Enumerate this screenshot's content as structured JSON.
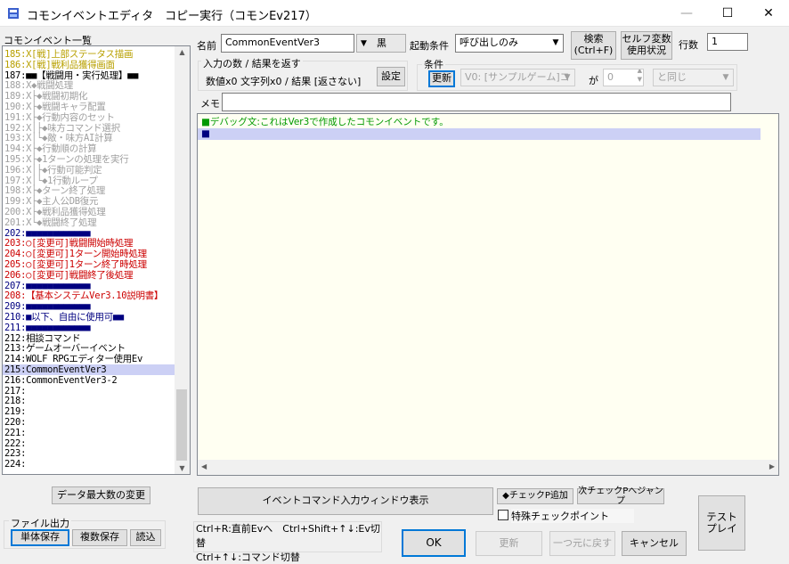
{
  "window": {
    "title": "コモンイベントエディタ　コピー実行（コモンEv217）",
    "minimize": "—",
    "maximize": "☐",
    "close": "✕"
  },
  "list": {
    "header": "コモンイベント一覧",
    "items": [
      {
        "text": "185:X[戦]上部ステータス描画",
        "color": "#b8a000"
      },
      {
        "text": "186:X[戦]戦利品獲得画面",
        "color": "#b8a000"
      },
      {
        "text": "187:■■【戦闘用・実行処理】■■",
        "color": "#000000"
      },
      {
        "text": "188:X◆戦闘処理",
        "color": "#a0a0a0"
      },
      {
        "text": "189:X├◆戦闘初期化",
        "color": "#a0a0a0"
      },
      {
        "text": "190:X├◆戦闘キャラ配置",
        "color": "#a0a0a0"
      },
      {
        "text": "191:X├◆行動内容のセット",
        "color": "#a0a0a0"
      },
      {
        "text": "192:X│├◆味方コマンド選択",
        "color": "#a0a0a0"
      },
      {
        "text": "193:X│└◆敵・味方AI計算",
        "color": "#a0a0a0"
      },
      {
        "text": "194:X├◆行動順の計算",
        "color": "#a0a0a0"
      },
      {
        "text": "195:X├◆1ターンの処理を実行",
        "color": "#a0a0a0"
      },
      {
        "text": "196:X│├◆行動可能判定",
        "color": "#a0a0a0"
      },
      {
        "text": "197:X│└◆1行動ループ",
        "color": "#a0a0a0"
      },
      {
        "text": "198:X├◆ターン終了処理",
        "color": "#a0a0a0"
      },
      {
        "text": "199:X├◆主人公DB復元",
        "color": "#a0a0a0"
      },
      {
        "text": "200:X├◆戦利品獲得処理",
        "color": "#a0a0a0"
      },
      {
        "text": "201:X└◆戦闘終了処理",
        "color": "#a0a0a0"
      },
      {
        "text": "202:■■■■■■■■■■■■",
        "color": "#000080"
      },
      {
        "text": "203:○[変更可]戦闘開始時処理",
        "color": "#cc0000"
      },
      {
        "text": "204:○[変更可]1ターン開始時処理",
        "color": "#cc0000"
      },
      {
        "text": "205:○[変更可]1ターン終了時処理",
        "color": "#cc0000"
      },
      {
        "text": "206:○[変更可]戦闘終了後処理",
        "color": "#cc0000"
      },
      {
        "text": "207:■■■■■■■■■■■■",
        "color": "#000080"
      },
      {
        "text": "208:【基本システムVer3.10説明書】",
        "color": "#cc0000"
      },
      {
        "text": "209:■■■■■■■■■■■■",
        "color": "#000080"
      },
      {
        "text": "210:■以下、自由に使用可■■",
        "color": "#000080"
      },
      {
        "text": "211:■■■■■■■■■■■■",
        "color": "#000080"
      },
      {
        "text": "212:相談コマンド",
        "color": "#000000"
      },
      {
        "text": "213:ゲームオーバーイベント",
        "color": "#000000"
      },
      {
        "text": "214:WOLF RPGエディター使用Ev",
        "color": "#000000"
      },
      {
        "text": "215:CommonEventVer3",
        "color": "#000000"
      },
      {
        "text": "216:CommonEventVer3-2",
        "color": "#000000"
      },
      {
        "text": "217:",
        "color": "#000000"
      },
      {
        "text": "218:",
        "color": "#000000"
      },
      {
        "text": "219:",
        "color": "#000000"
      },
      {
        "text": "220:",
        "color": "#000000"
      },
      {
        "text": "221:",
        "color": "#000000"
      },
      {
        "text": "222:",
        "color": "#000000"
      },
      {
        "text": "223:",
        "color": "#000000"
      },
      {
        "text": "224:",
        "color": "#000000"
      }
    ]
  },
  "top": {
    "name_label": "名前",
    "name_value": "CommonEventVer3",
    "color_value": "黒",
    "trigger_label": "起動条件",
    "trigger_value": "呼び出しのみ",
    "search_btn": "検索\n(Ctrl+F)",
    "self_var_btn": "セルフ変数\n使用状況",
    "lines_label": "行数",
    "lines_value": "1"
  },
  "io": {
    "group_label": "入力の数 / 結果を返す",
    "summary": "数値x0 文字列x0 / 結果 [返さない]",
    "set_btn": "設定"
  },
  "cond": {
    "group_label": "条件",
    "update_btn": "更新",
    "var_value": "V0: [サンプルゲーム]コ",
    "ga_label": "が",
    "num_value": "0",
    "compare_value": "と同じ"
  },
  "memo": {
    "label": "メモ",
    "value": ""
  },
  "editor": {
    "lines": [
      {
        "text": "■デバッグ文:これはVer3で作成したコモンイベントです。",
        "color": "#009900"
      },
      {
        "text": "■",
        "color": "#000080"
      }
    ]
  },
  "bottom": {
    "max_data_btn": "データ最大数の変更",
    "file_group": "ファイル出力",
    "single_save": "単体保存",
    "multi_save": "複数保存",
    "load": "読込",
    "cmd_window_btn": "イベントコマンド入力ウィンドウ表示",
    "check_add": "◆チェックP追加",
    "check_jump": "次チェックPへジャンプ",
    "special_check": "特殊チェックポイント",
    "test_play": "テスト\nプレイ",
    "help1": "Ctrl+R:直前Evへ　Ctrl+Shift+↑↓:Ev切替",
    "help2": "Ctrl+↑↓:コマンド切替",
    "ok": "OK",
    "update": "更新",
    "undo": "一つ元に戻す",
    "cancel": "キャンセル"
  }
}
